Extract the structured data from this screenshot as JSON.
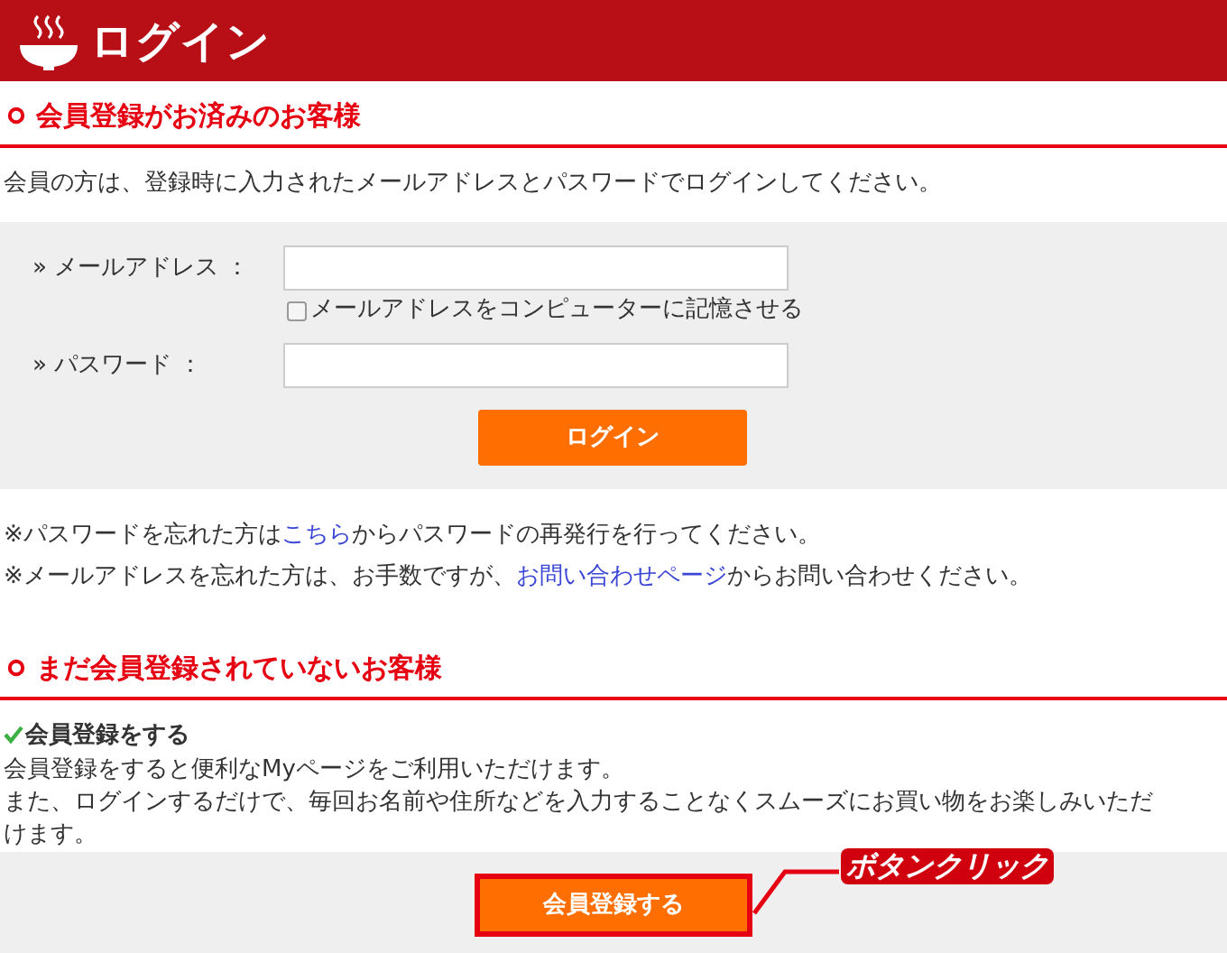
{
  "header": {
    "title": "ログイン"
  },
  "member_section": {
    "heading": "会員登録がお済みのお客様",
    "intro": "会員の方は、登録時に入力されたメールアドレスとパスワードでログインしてください。",
    "fields": [
      {
        "label": "» メールアドレス ："
      },
      {
        "label": "» パスワード ："
      }
    ],
    "remember": {
      "label": "メールアドレスをコンピューターに記憶させる",
      "checked": false
    },
    "login_button": "ログイン",
    "notes": [
      {
        "before": "※パスワードを忘れた方は",
        "link": "こちら",
        "after": "からパスワードの再発行を行ってください。"
      },
      {
        "before": "※メールアドレスを忘れた方は、お手数ですが、",
        "link": "お問い合わせページ",
        "after": "からお問い合わせください。"
      }
    ]
  },
  "guest_section": {
    "heading": "まだ会員登録されていないお客様",
    "benefit_title": "会員登録をする",
    "benefit_lines": [
      "会員登録をすると便利なMyページをご利用いただけます。",
      "また、ログインするだけで、毎回お名前や住所などを入力することなくスムーズにお買い物をお楽しみいただけます。"
    ],
    "register_button": "会員登録する"
  },
  "annotation": {
    "text": "ボタンクリック"
  }
}
